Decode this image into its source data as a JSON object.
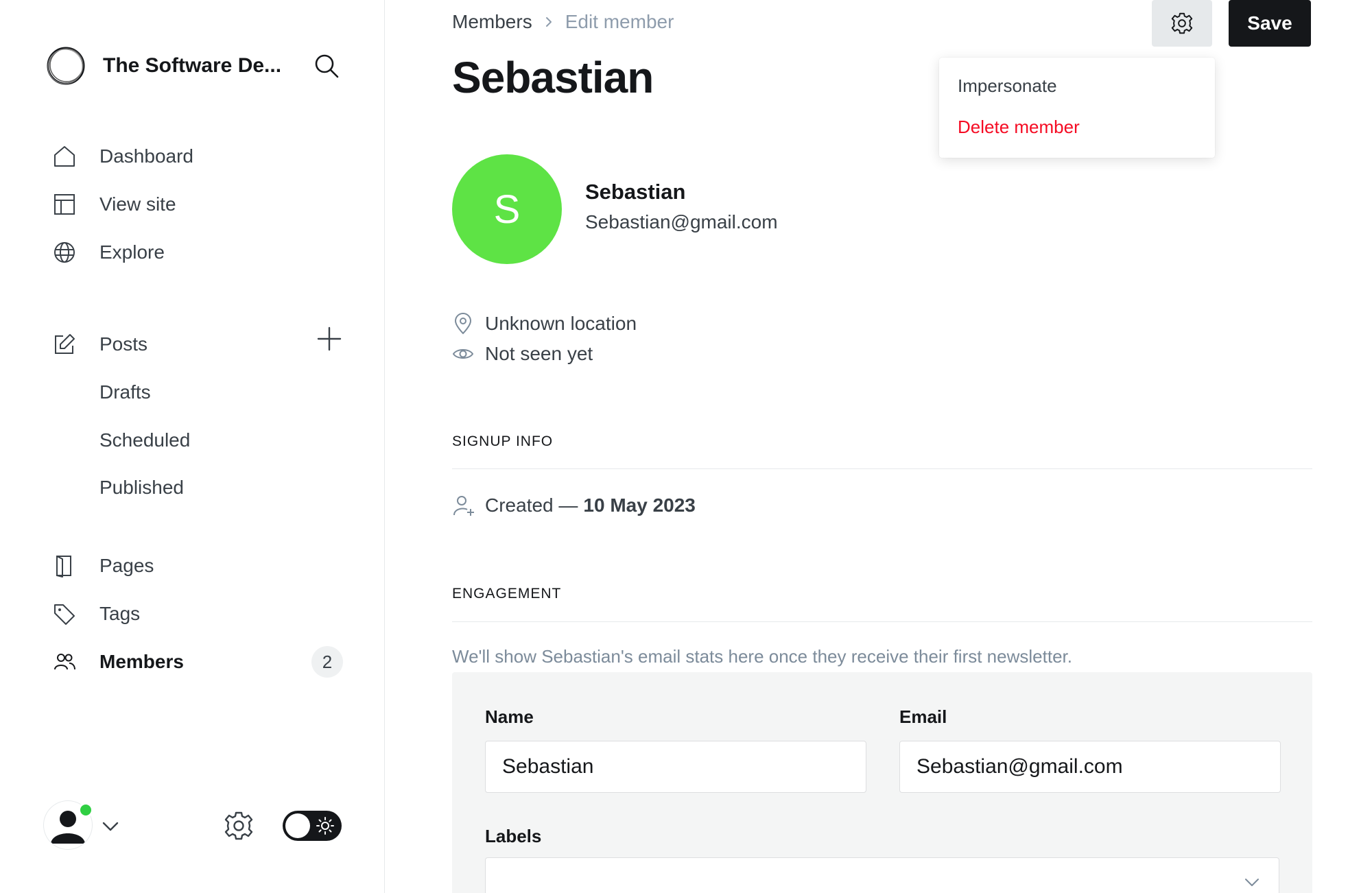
{
  "app": {
    "site_title": "The Software De...",
    "brand_color": "#15171a"
  },
  "sidebar": {
    "nav_primary": [
      {
        "label": "Dashboard",
        "icon": "home-icon"
      },
      {
        "label": "View site",
        "icon": "layout-icon"
      },
      {
        "label": "Explore",
        "icon": "globe-icon"
      }
    ],
    "posts": {
      "label": "Posts",
      "icon": "edit-icon",
      "sub": [
        "Drafts",
        "Scheduled",
        "Published"
      ]
    },
    "nav_secondary": [
      {
        "label": "Pages",
        "icon": "page-icon"
      },
      {
        "label": "Tags",
        "icon": "tag-icon"
      },
      {
        "label": "Members",
        "icon": "members-icon",
        "count": "2",
        "active": true
      }
    ]
  },
  "header": {
    "breadcrumb_parent": "Members",
    "breadcrumb_current": "Edit member",
    "save_label": "Save"
  },
  "page": {
    "title": "Sebastian"
  },
  "actions_menu": {
    "impersonate": "Impersonate",
    "delete": "Delete member",
    "delete_color": "#f50b23"
  },
  "member": {
    "initial": "S",
    "name": "Sebastian",
    "email": "Sebastian@gmail.com",
    "avatar_color": "#5ee345",
    "location": "Unknown location",
    "last_seen": "Not seen yet"
  },
  "signup": {
    "heading": "SIGNUP INFO",
    "created_prefix": "Created —",
    "created_date": "10 May 2023"
  },
  "engagement": {
    "heading": "ENGAGEMENT",
    "note": "We'll show Sebastian's email stats here once they receive their first newsletter."
  },
  "form": {
    "name_label": "Name",
    "name_value": "Sebastian",
    "email_label": "Email",
    "email_value": "Sebastian@gmail.com",
    "labels_label": "Labels"
  }
}
